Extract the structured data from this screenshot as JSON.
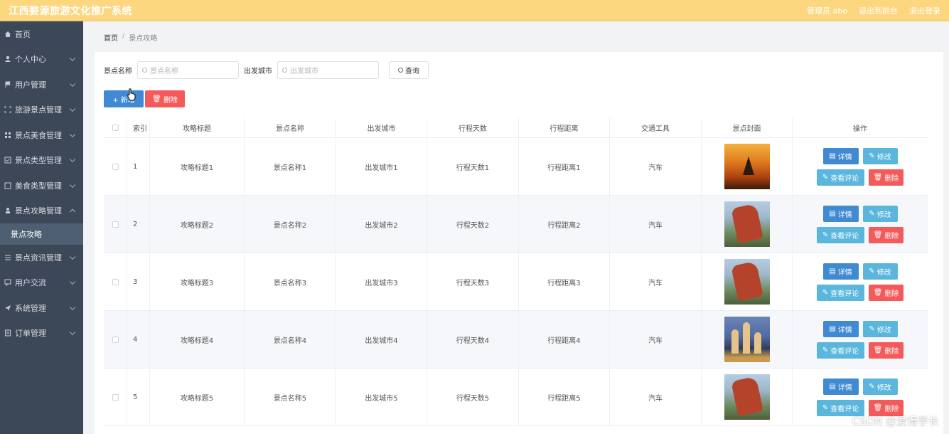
{
  "topbar": {
    "title": "江西婺源旅游文化推广系统",
    "user_label": "管理员 abo",
    "back_label": "退出到前台",
    "logout_label": "退出登录"
  },
  "sidebar": {
    "items": [
      {
        "label": "首页",
        "icon": "home-icon"
      },
      {
        "label": "个人中心",
        "icon": "user-icon"
      },
      {
        "label": "用户管理",
        "icon": "flag-icon"
      },
      {
        "label": "旅游景点管理",
        "icon": "fullscreen-icon"
      },
      {
        "label": "景点美食管理",
        "icon": "grid-icon"
      },
      {
        "label": "景点类型管理",
        "icon": "checkbox-icon"
      },
      {
        "label": "美食类型管理",
        "icon": "square-icon"
      },
      {
        "label": "景点攻略管理",
        "icon": "person-icon"
      },
      {
        "label": "景点资讯管理",
        "icon": "list-icon"
      },
      {
        "label": "用户交流",
        "icon": "chat-icon"
      },
      {
        "label": "系统管理",
        "icon": "send-icon"
      },
      {
        "label": "订单管理",
        "icon": "order-icon"
      }
    ],
    "active_sub": "景点攻略"
  },
  "breadcrumb": {
    "home": "首页",
    "current": "景点攻略"
  },
  "search": {
    "name_label": "景点名称",
    "name_placeholder": "景点名称",
    "city_label": "出发城市",
    "city_placeholder": "出发城市",
    "query_label": "查询"
  },
  "actions": {
    "add_label": "+ 新增",
    "delete_label": "删除"
  },
  "table": {
    "headers": [
      "索引",
      "攻略标题",
      "景点名称",
      "出发城市",
      "行程天数",
      "行程距离",
      "交通工具",
      "景点封面",
      "操作"
    ],
    "rows": [
      {
        "index": "1",
        "title": "攻略标题1",
        "spot": "景点名称1",
        "city": "出发城市1",
        "days": "行程天数1",
        "distance": "行程距离1",
        "transport": "汽车",
        "cover": "sunset"
      },
      {
        "index": "2",
        "title": "攻略标题2",
        "spot": "景点名称2",
        "city": "出发城市2",
        "days": "行程天数2",
        "distance": "行程距离2",
        "transport": "汽车",
        "cover": "rock"
      },
      {
        "index": "3",
        "title": "攻略标题3",
        "spot": "景点名称3",
        "city": "出发城市3",
        "days": "行程天数3",
        "distance": "行程距离3",
        "transport": "汽车",
        "cover": "rock"
      },
      {
        "index": "4",
        "title": "攻略标题4",
        "spot": "景点名称4",
        "city": "出发城市4",
        "days": "行程天数4",
        "distance": "行程距离4",
        "transport": "汽车",
        "cover": "city"
      },
      {
        "index": "5",
        "title": "攻略标题5",
        "spot": "景点名称5",
        "city": "出发城市5",
        "days": "行程天数5",
        "distance": "行程距离5",
        "transport": "汽车",
        "cover": "rock"
      }
    ],
    "row_buttons": {
      "detail": "详情",
      "edit": "修改",
      "comment": "查看评论",
      "delete": "删除"
    }
  },
  "watermark": "CSDN @爱得学长",
  "colors": {
    "topbar": "#fcd77f",
    "sidebar": "#3c4758",
    "primary": "#3f8ad2",
    "info": "#5ab6dc",
    "danger": "#f45a5a"
  }
}
